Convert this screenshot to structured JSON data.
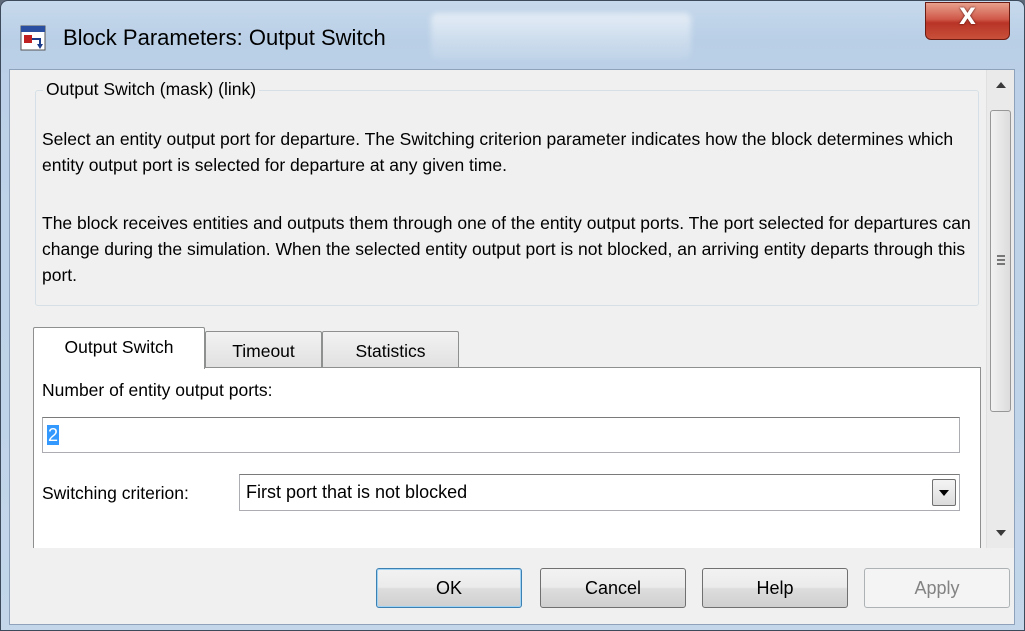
{
  "window": {
    "title": "Block Parameters: Output Switch",
    "close_label": "X"
  },
  "description": {
    "legend": "Output Switch (mask) (link)",
    "paragraph1": "Select an entity output port for departure. The Switching criterion parameter indicates how the block determines which entity output port is selected for departure at any given time.",
    "paragraph2": "The block receives entities and outputs them through one of the entity output ports. The port selected for departures can change during the simulation. When the selected entity output port is not blocked, an arriving entity departs through this port."
  },
  "tabs": [
    {
      "label": "Output Switch",
      "active": true
    },
    {
      "label": "Timeout",
      "active": false
    },
    {
      "label": "Statistics",
      "active": false
    }
  ],
  "params": {
    "num_ports_label": "Number of entity output ports:",
    "num_ports_value": "2",
    "criterion_label": "Switching criterion:",
    "criterion_value": "First port that is not blocked"
  },
  "buttons": {
    "ok": "OK",
    "cancel": "Cancel",
    "help": "Help",
    "apply": "Apply"
  },
  "icons": [
    "block-parameters-icon",
    "close-icon",
    "scroll-up-icon",
    "scroll-down-icon",
    "dropdown-arrow-icon"
  ]
}
